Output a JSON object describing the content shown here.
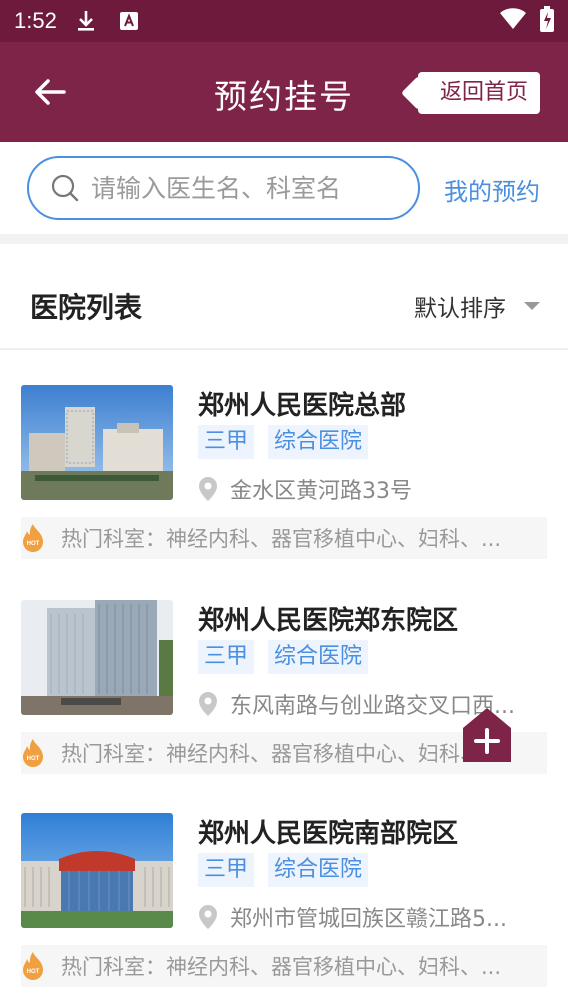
{
  "status_bar": {
    "time": "1:52",
    "icons": [
      "download-icon",
      "a-notification-icon",
      "wifi-icon",
      "battery-charging-icon"
    ]
  },
  "header": {
    "title": "预约挂号",
    "back_icon": "arrow-left-icon",
    "home_button": "返回首页"
  },
  "search": {
    "placeholder": "请输入医生名、科室名",
    "my_appointments": "我的预约"
  },
  "list": {
    "title": "医院列表",
    "sort_label": "默认排序"
  },
  "hospitals": [
    {
      "name": "郑州人民医院总部",
      "tags": [
        "三甲",
        "综合医院"
      ],
      "address": "金水区黄河路33号",
      "hot_departments": "热门科室：神经内科、器官移植中心、妇科、..."
    },
    {
      "name": "郑州人民医院郑东院区",
      "tags": [
        "三甲",
        "综合医院"
      ],
      "address": "东风南路与创业路交叉口西...",
      "hot_departments": "热门科室：神经内科、器官移植中心、妇科、..."
    },
    {
      "name": "郑州人民医院南部院区",
      "tags": [
        "三甲",
        "综合医院"
      ],
      "address": "郑州市管城回族区赣江路5...",
      "hot_departments": "热门科室：神经内科、器官移植中心、妇科、..."
    }
  ],
  "floating_button_icon": "house-plus-icon",
  "colors": {
    "status_bar": "#6e1a3d",
    "header": "#7f2449",
    "accent_blue": "#4a8fe0",
    "hot_orange": "#f0a040"
  }
}
